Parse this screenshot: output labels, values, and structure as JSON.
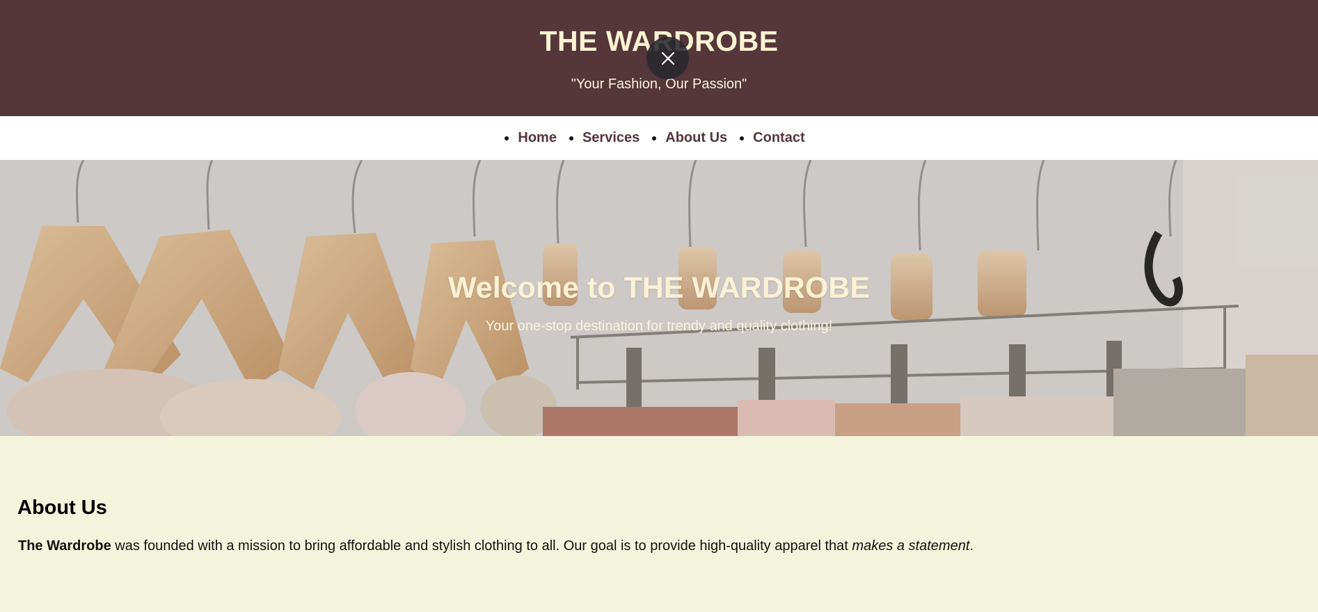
{
  "header": {
    "brand": "THE WARDROBE",
    "tagline": "\"Your Fashion, Our Passion\""
  },
  "overlay": {
    "close_icon": "close-icon"
  },
  "nav": {
    "items": [
      {
        "label": "Home"
      },
      {
        "label": "Services"
      },
      {
        "label": "About Us"
      },
      {
        "label": "Contact"
      }
    ]
  },
  "hero": {
    "title": "Welcome to THE WARDROBE",
    "subtitle": "Your one-stop destination for trendy and quality clothing!"
  },
  "about": {
    "title": "About Us",
    "strong": "The Wardrobe",
    "text_mid": " was founded with a mission to bring affordable and stylish clothing to all. Our goal is to provide high-quality apparel that ",
    "emphasis": "makes a statement",
    "text_end": "."
  },
  "colors": {
    "header_bg": "#55363a",
    "header_text": "#fdf3d2",
    "nav_link": "#55363a",
    "page_bg": "#f4f4dc"
  }
}
